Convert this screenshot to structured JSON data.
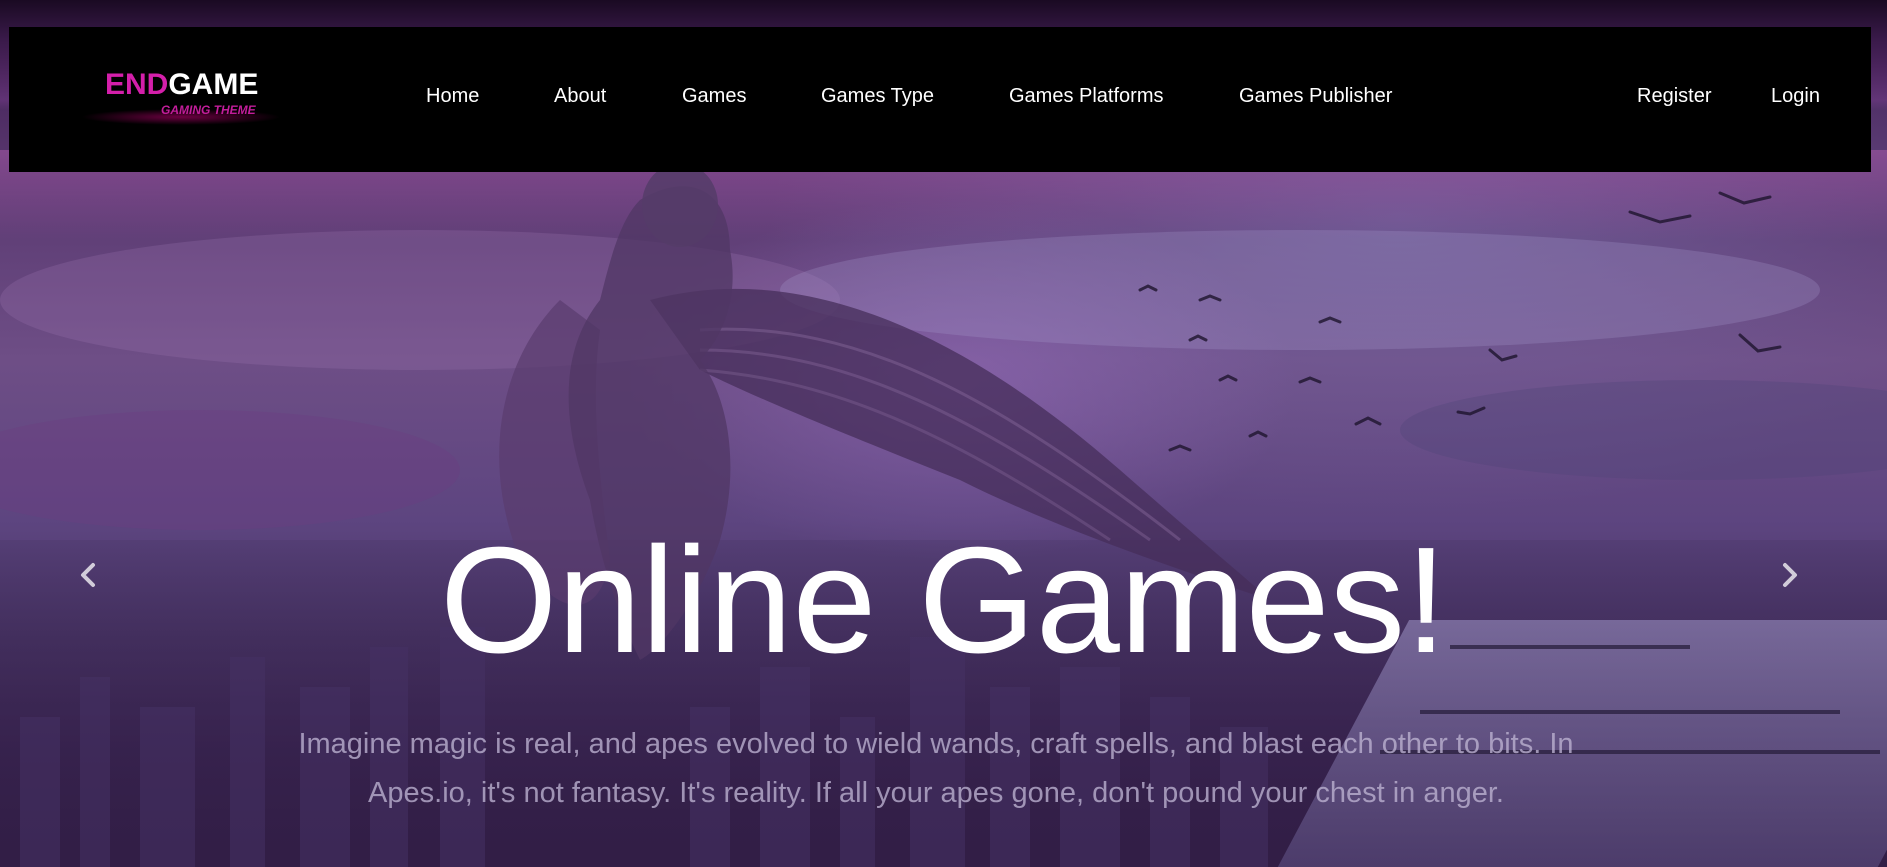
{
  "brand": {
    "logo_part1": "END",
    "logo_part2": "GAME",
    "tagline": "GAMING THEME",
    "accent_color": "#d41faa"
  },
  "nav": {
    "items": [
      {
        "label": "Home"
      },
      {
        "label": "About"
      },
      {
        "label": "Games"
      },
      {
        "label": "Games Type"
      },
      {
        "label": "Games Platforms"
      },
      {
        "label": "Games Publisher"
      }
    ],
    "auth": {
      "register_label": "Register",
      "login_label": "Login"
    }
  },
  "carousel": {
    "headline": "Online Games!",
    "description": "Imagine magic is real, and apes evolved to wield wands, craft spells, and blast each other to bits. In Apes.io, it's not fantasy. It's reality. If all your apes gone, don't pound your chest in anger.",
    "prev_icon": "chevron-left-icon",
    "next_icon": "chevron-right-icon"
  },
  "colors": {
    "navbar_bg": "#000000",
    "hero_overlay": "#5b3a72",
    "text_primary": "#ffffff"
  }
}
